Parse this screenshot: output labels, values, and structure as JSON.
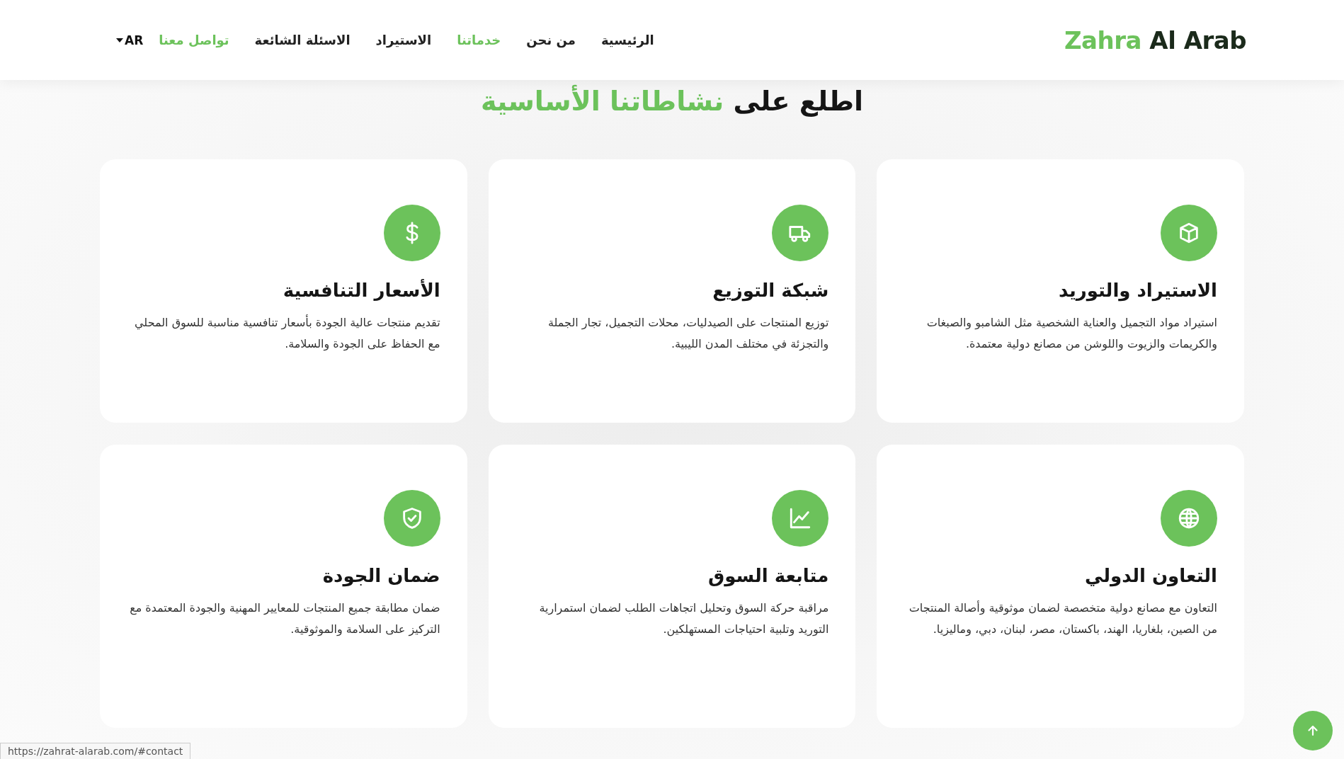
{
  "header": {
    "logo": {
      "first": "Zahra",
      "second": "Al Arab"
    },
    "nav": [
      {
        "label": "الرئيسية",
        "selected": false
      },
      {
        "label": "من نحن",
        "selected": false
      },
      {
        "label": "خدماتنا",
        "selected": true
      },
      {
        "label": "الاستيراد",
        "selected": false
      },
      {
        "label": "الاسئلة الشائعة",
        "selected": false
      }
    ],
    "contact_link": "تواصل معنا",
    "language": "AR"
  },
  "section_title": {
    "text": "اطلع على",
    "highlight": "نشاطاتنا الأساسية"
  },
  "cards": [
    {
      "kind": "box",
      "title": "الاستيراد والتوريد",
      "text": "استيراد مواد التجميل والعناية الشخصية مثل الشامبو والصبغات والكريمات والزيوت واللوشن من مصانع دولية معتمدة."
    },
    {
      "kind": "truck",
      "title": "شبكة التوزيع",
      "text": "توزيع المنتجات على الصيدليات، محلات التجميل، تجار الجملة والتجزئة في مختلف المدن الليبية."
    },
    {
      "kind": "dollar",
      "title": "الأسعار التنافسية",
      "text": "تقديم منتجات عالية الجودة بأسعار تنافسية مناسبة للسوق المحلي مع الحفاظ على الجودة والسلامة."
    },
    {
      "kind": "globe",
      "title": "التعاون الدولي",
      "text": "التعاون مع مصانع دولية متخصصة لضمان موثوقية وأصالة المنتجات من الصين، بلغاريا، الهند، باكستان، مصر، لبنان، دبي، وماليزيا."
    },
    {
      "kind": "chart",
      "title": "متابعة السوق",
      "text": "مراقبة حركة السوق وتحليل اتجاهات الطلب لضمان استمرارية التوريد وتلبية احتياجات المستهلكين."
    },
    {
      "kind": "shield",
      "title": "ضمان الجودة",
      "text": "ضمان مطابقة جميع المنتجات للمعايير المهنية والجودة المعتمدة مع التركيز على السلامة والموثوقية."
    }
  ],
  "status_bar": "https://zahrat-alarab.com/#contact"
}
